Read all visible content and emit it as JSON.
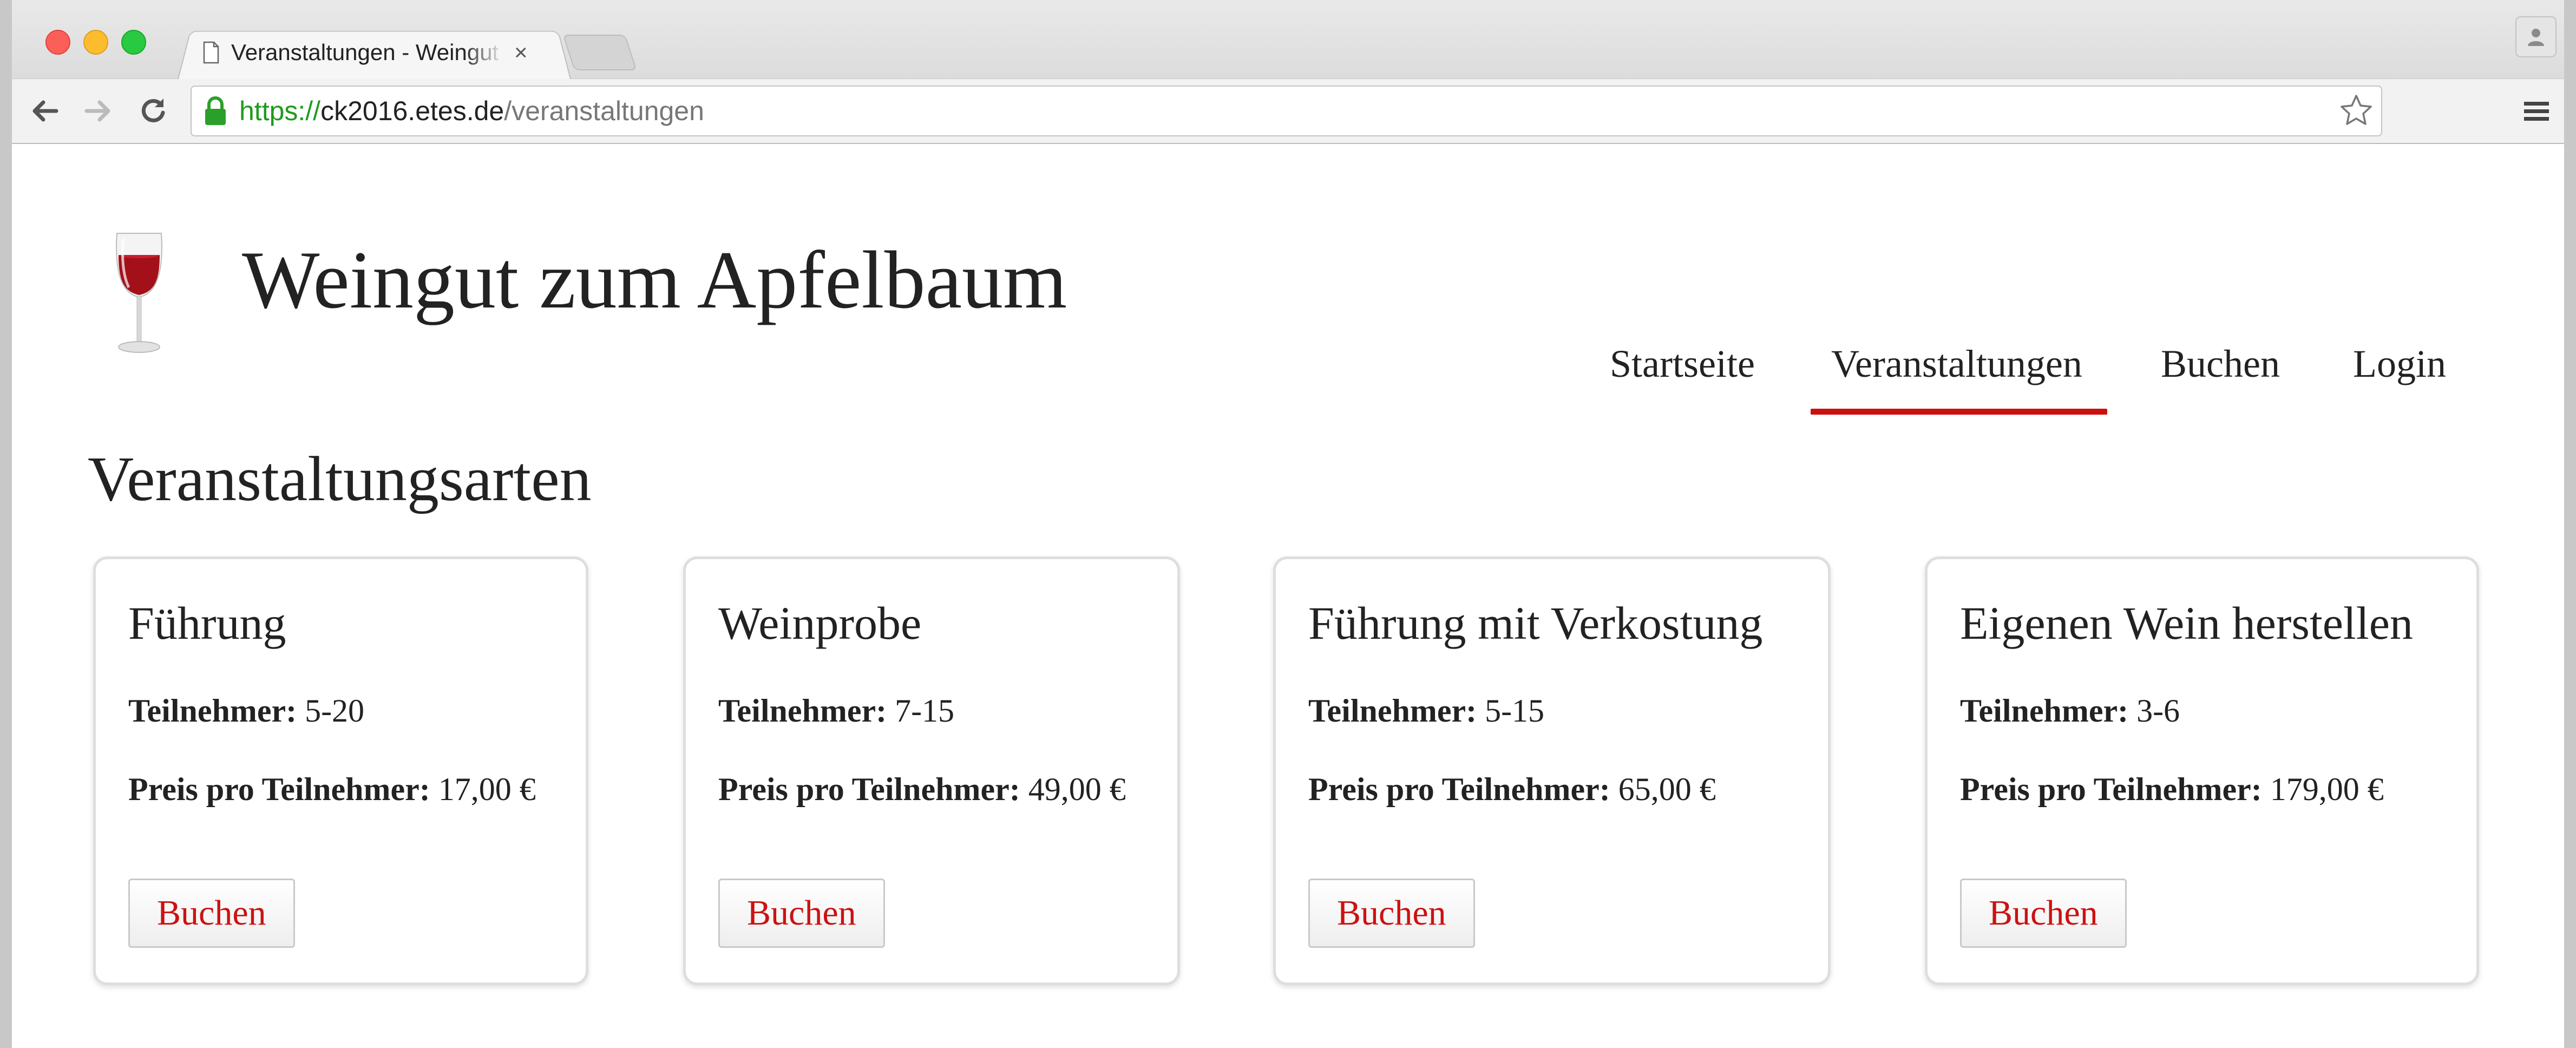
{
  "browser": {
    "tab_title": "Veranstaltungen - Weingut zum Apfelbaum",
    "tab_close": "×",
    "url_scheme": "https://",
    "url_host": "ck2016.etes.de",
    "url_path": "/veranstaltungen"
  },
  "site": {
    "title": "Weingut zum Apfelbaum",
    "logo_icon": "wine-glass-icon",
    "accent_color": "#cc1111"
  },
  "nav": {
    "items": [
      {
        "label": "Startseite",
        "active": false
      },
      {
        "label": "Veranstaltungen",
        "active": true
      },
      {
        "label": "Buchen",
        "active": false
      },
      {
        "label": "Login",
        "active": false
      }
    ]
  },
  "main": {
    "section_title": "Veranstaltungsarten",
    "participants_label": "Teilnehmer:",
    "price_label": "Preis pro Teilnehmer:",
    "events": [
      {
        "title": "Führung",
        "participants": "5-20",
        "price": "17,00 €",
        "button": "Buchen"
      },
      {
        "title": "Weinprobe",
        "participants": "7-15",
        "price": "49,00 €",
        "button": "Buchen"
      },
      {
        "title": "Führung mit Verkostung",
        "participants": "5-15",
        "price": "65,00 €",
        "button": "Buchen"
      },
      {
        "title": "Eigenen Wein herstellen",
        "participants": "3-6",
        "price": "179,00 €",
        "button": "Buchen"
      }
    ]
  }
}
